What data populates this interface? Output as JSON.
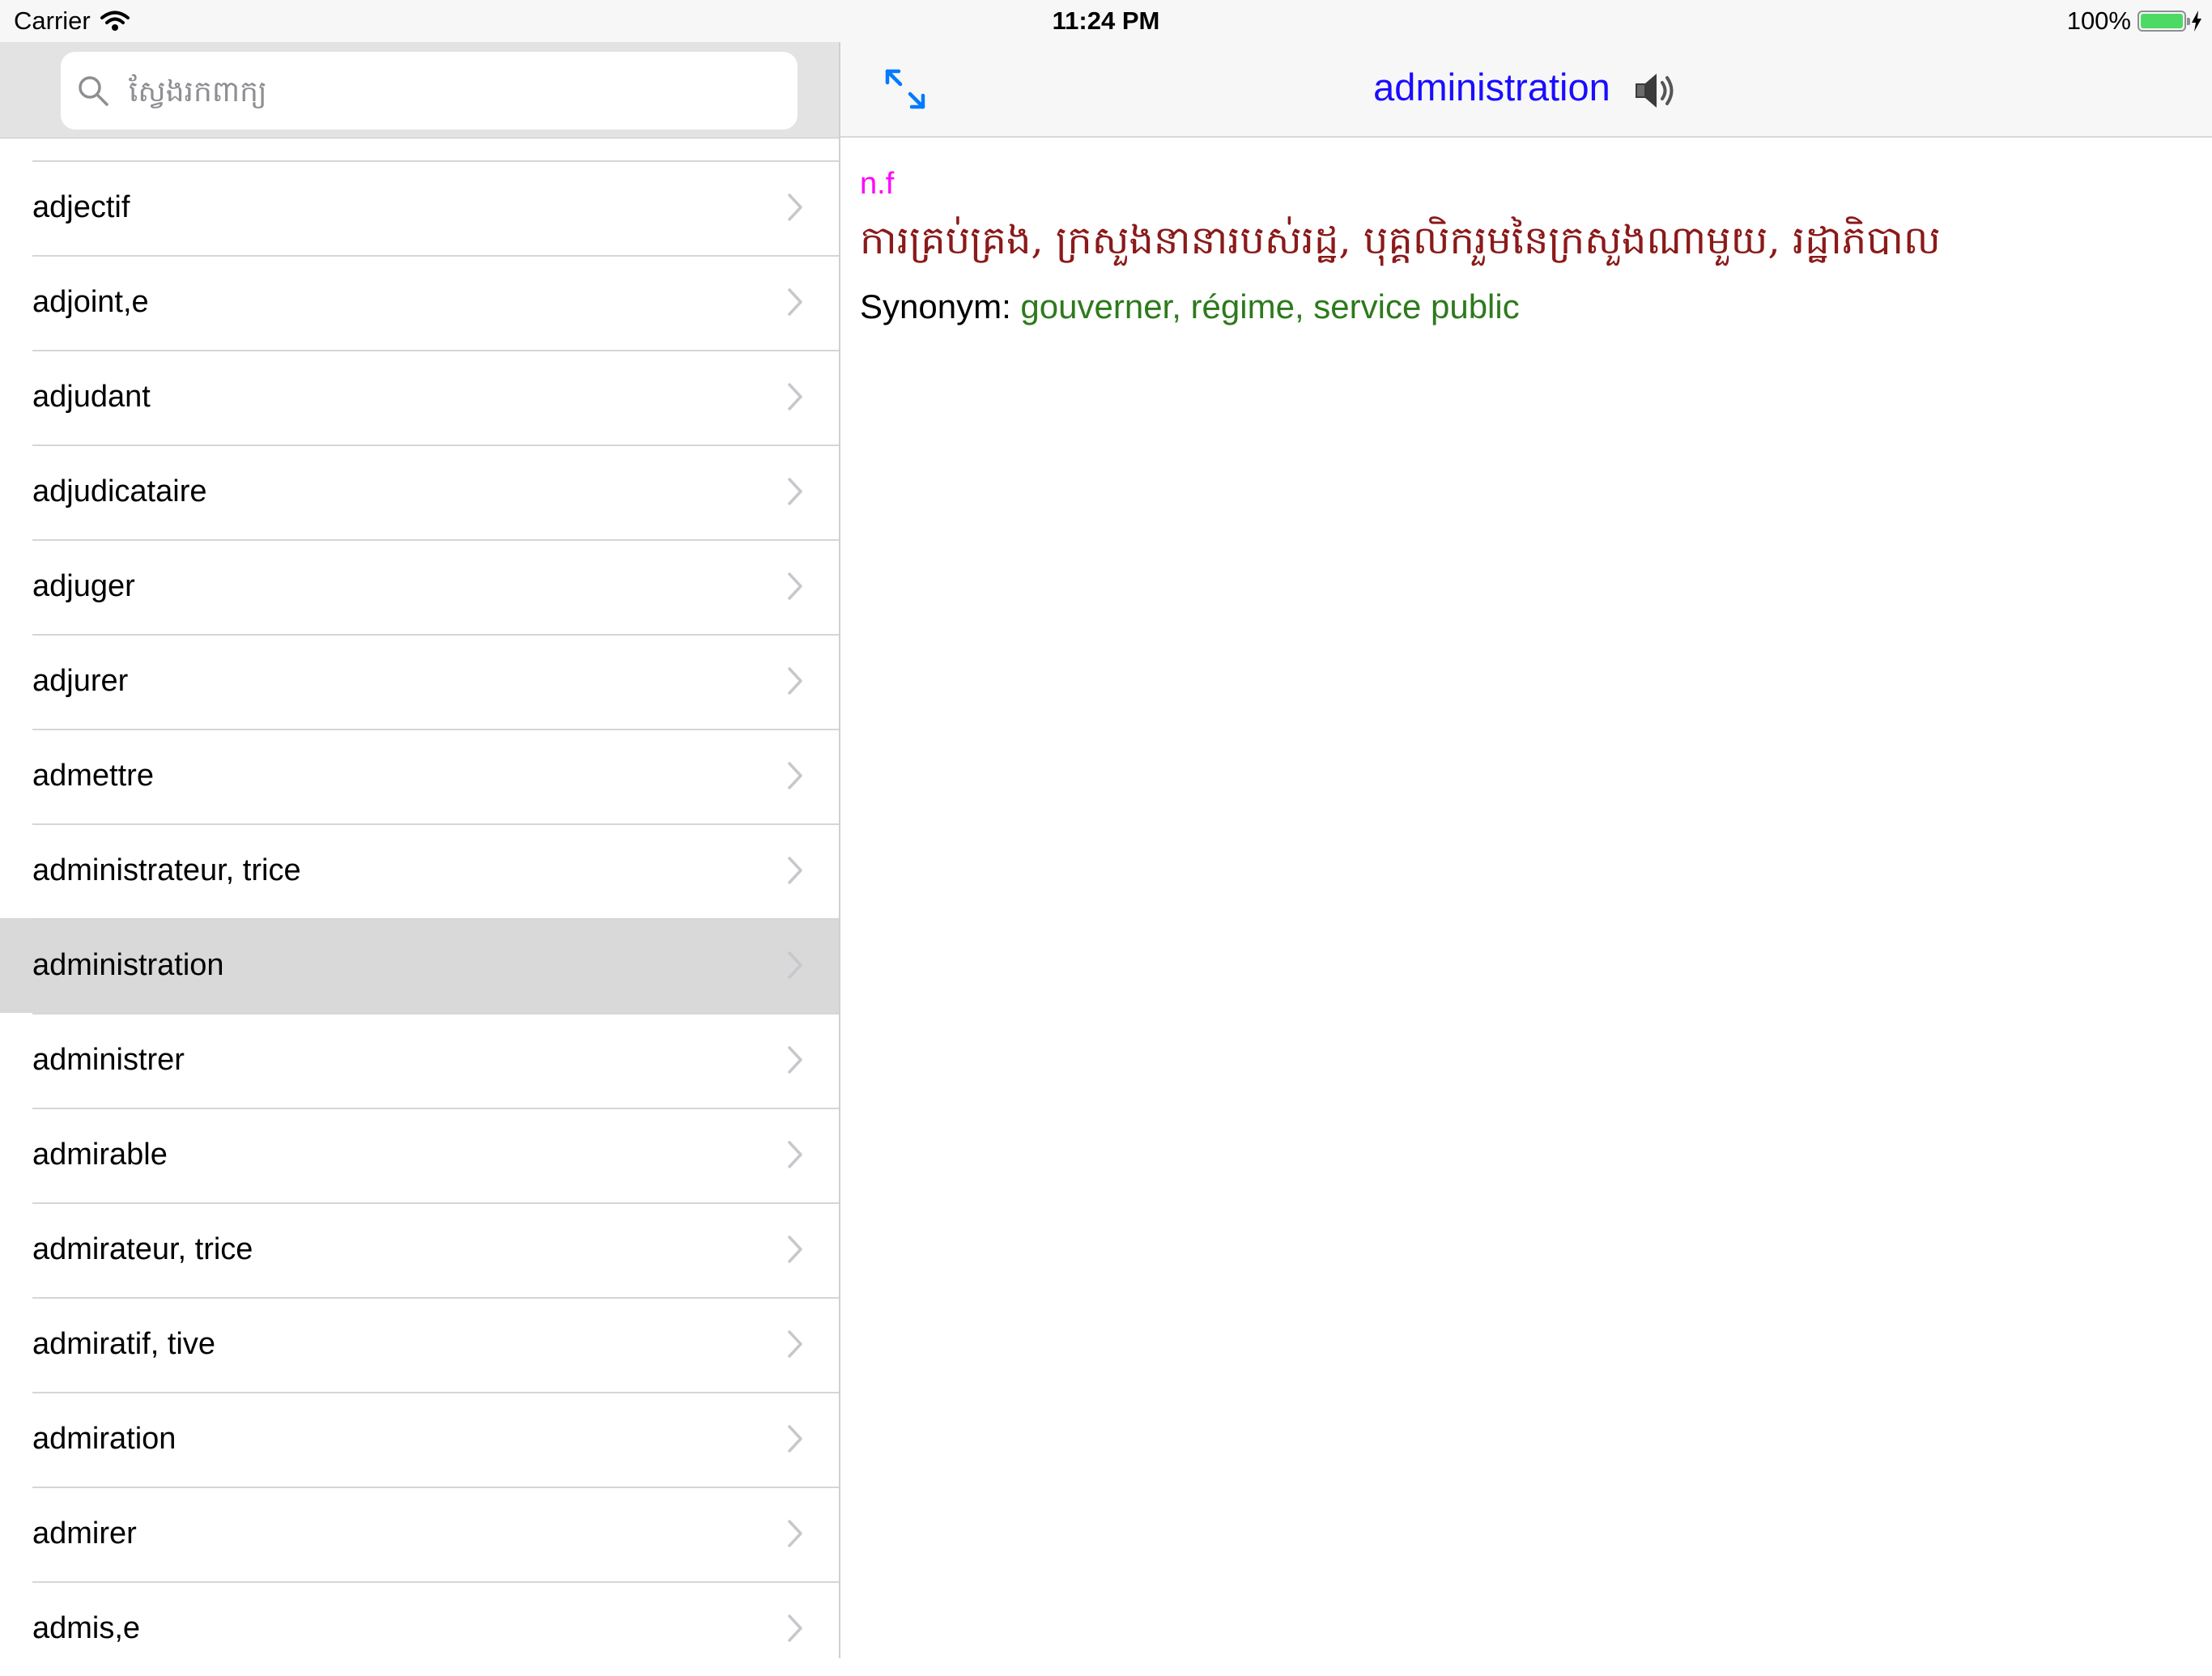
{
  "status_bar": {
    "carrier": "Carrier",
    "time": "11:24 PM",
    "battery": "100%"
  },
  "search": {
    "placeholder": "ស្វែងរកពាក្យ"
  },
  "word_list": [
    "adjectif",
    "adjoint,e",
    "adjudant",
    "adjudicataire",
    "adjuger",
    "adjurer",
    "admettre",
    "administrateur, trice",
    "administration",
    "administrer",
    "admirable",
    "admirateur, trice",
    "admiratif, tive",
    "admiration",
    "admirer",
    "admis,e"
  ],
  "selected_word": "administration",
  "detail": {
    "title": "administration",
    "part_of_speech": "n.f",
    "definition": "ការគ្រប់គ្រង, ក្រសួងនានារបស់រដ្ឋ, បុគ្គលិករួមនៃក្រសួងណាមួយ, រដ្ឋាភិបាល",
    "synonym_label": "Synonym:",
    "synonyms": "gouverner, régime, service public"
  },
  "colors": {
    "accent": "#007aff",
    "title": "#1a0dff",
    "pos": "#ff00ff",
    "definition": "#8b1a1a",
    "synonyms": "#2d7a1c",
    "selected_row": "#d9d9d9"
  },
  "icons": [
    "wifi-icon",
    "battery-icon",
    "charging-bolt-icon",
    "search-icon",
    "chevron-right-icon",
    "expand-icon",
    "speaker-icon"
  ]
}
